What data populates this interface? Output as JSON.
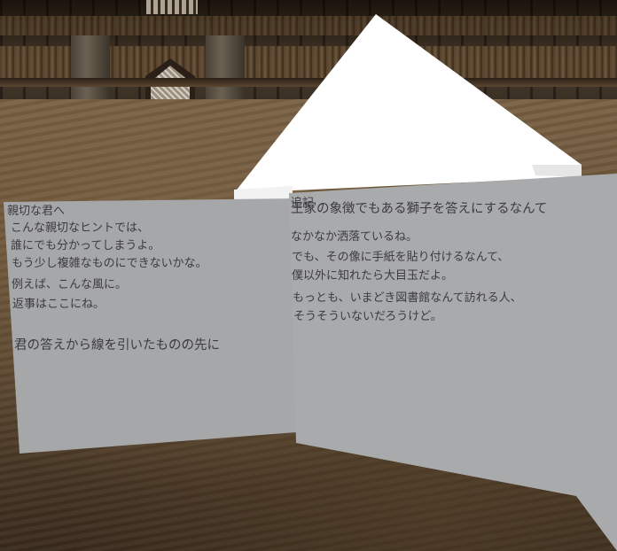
{
  "scene": {
    "name": "library-hall",
    "colors": {
      "paper": "#a6a7a9",
      "ink": "#3c3c3e",
      "highlight": "#ffffff",
      "floor": "#6a5238"
    }
  },
  "note_left": {
    "greeting": "親切な君へ",
    "lines": [
      "こんな親切なヒントでは、",
      "誰にでも分かってしまうよ。",
      "もう少し複雑なものにできないかな。",
      "例えば、こんな風に。",
      "返事はここにね。"
    ],
    "clue": "君の答えから線を引いたものの先に"
  },
  "note_right": {
    "heading": "追記",
    "lines": [
      "王家の象徴でもある獅子を答えにするなんて",
      "なかなか洒落ているね。",
      "でも、その像に手紙を貼り付けるなんて、",
      "僕以外に知れたら大目玉だよ。",
      "もっとも、いまどき図書館なんて訪れる人、",
      "そうそういないだろうけど。"
    ]
  }
}
